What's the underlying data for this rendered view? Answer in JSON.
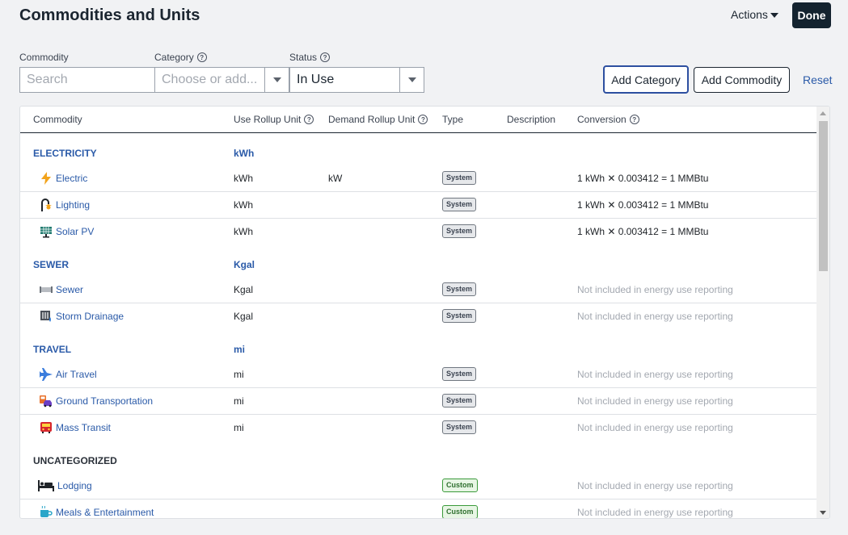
{
  "page": {
    "title": "Commodities and Units"
  },
  "header": {
    "actions_label": "Actions",
    "done_label": "Done"
  },
  "filters": {
    "commodity_label": "Commodity",
    "commodity_placeholder": "Search",
    "category_label": "Category",
    "category_placeholder": "Choose or add...",
    "status_label": "Status",
    "status_value": "In Use",
    "add_category": "Add Category",
    "add_commodity": "Add Commodity",
    "reset": "Reset"
  },
  "table": {
    "headers": {
      "commodity": "Commodity",
      "use_rollup": "Use Rollup Unit",
      "demand_rollup": "Demand Rollup Unit",
      "type": "Type",
      "description": "Description",
      "conversion": "Conversion"
    },
    "categories": [
      {
        "name": "ELECTRICITY",
        "unit": "kWh",
        "items": [
          {
            "name": "Electric",
            "icon": "lightning-icon",
            "use_unit": "kWh",
            "demand_unit": "kW",
            "type": "System",
            "conversion": "1 kWh ✕ 0.003412 = 1 MMBtu"
          },
          {
            "name": "Lighting",
            "icon": "lamp-icon",
            "use_unit": "kWh",
            "demand_unit": "",
            "type": "System",
            "conversion": "1 kWh ✕ 0.003412 = 1 MMBtu"
          },
          {
            "name": "Solar PV",
            "icon": "solar-panel-icon",
            "use_unit": "kWh",
            "demand_unit": "",
            "type": "System",
            "conversion": "1 kWh ✕ 0.003412 = 1 MMBtu"
          }
        ]
      },
      {
        "name": "SEWER",
        "unit": "Kgal",
        "items": [
          {
            "name": "Sewer",
            "icon": "pipe-icon",
            "use_unit": "Kgal",
            "demand_unit": "",
            "type": "System",
            "conversion": "Not included in energy use reporting"
          },
          {
            "name": "Storm Drainage",
            "icon": "drain-icon",
            "use_unit": "Kgal",
            "demand_unit": "",
            "type": "System",
            "conversion": "Not included in energy use reporting"
          }
        ]
      },
      {
        "name": "TRAVEL",
        "unit": "mi",
        "items": [
          {
            "name": "Air Travel",
            "icon": "airplane-icon",
            "use_unit": "mi",
            "demand_unit": "",
            "type": "System",
            "conversion": "Not included in energy use reporting"
          },
          {
            "name": "Ground Transportation",
            "icon": "car-bus-icon",
            "use_unit": "mi",
            "demand_unit": "",
            "type": "System",
            "conversion": "Not included in energy use reporting"
          },
          {
            "name": "Mass Transit",
            "icon": "bus-icon",
            "use_unit": "mi",
            "demand_unit": "",
            "type": "System",
            "conversion": "Not included in energy use reporting"
          }
        ]
      },
      {
        "name": "UNCATEGORIZED",
        "unit": "",
        "items": [
          {
            "name": "Lodging",
            "icon": "bed-icon",
            "use_unit": "",
            "demand_unit": "",
            "type": "Custom",
            "conversion": "Not included in energy use reporting"
          },
          {
            "name": "Meals & Entertainment",
            "icon": "coffee-cup-icon",
            "use_unit": "",
            "demand_unit": "",
            "type": "Custom",
            "conversion": "Not included in energy use reporting"
          }
        ]
      }
    ]
  },
  "colors": {
    "link": "#2a5aa8",
    "dark": "#14232f",
    "muted": "#a3a8b0"
  }
}
